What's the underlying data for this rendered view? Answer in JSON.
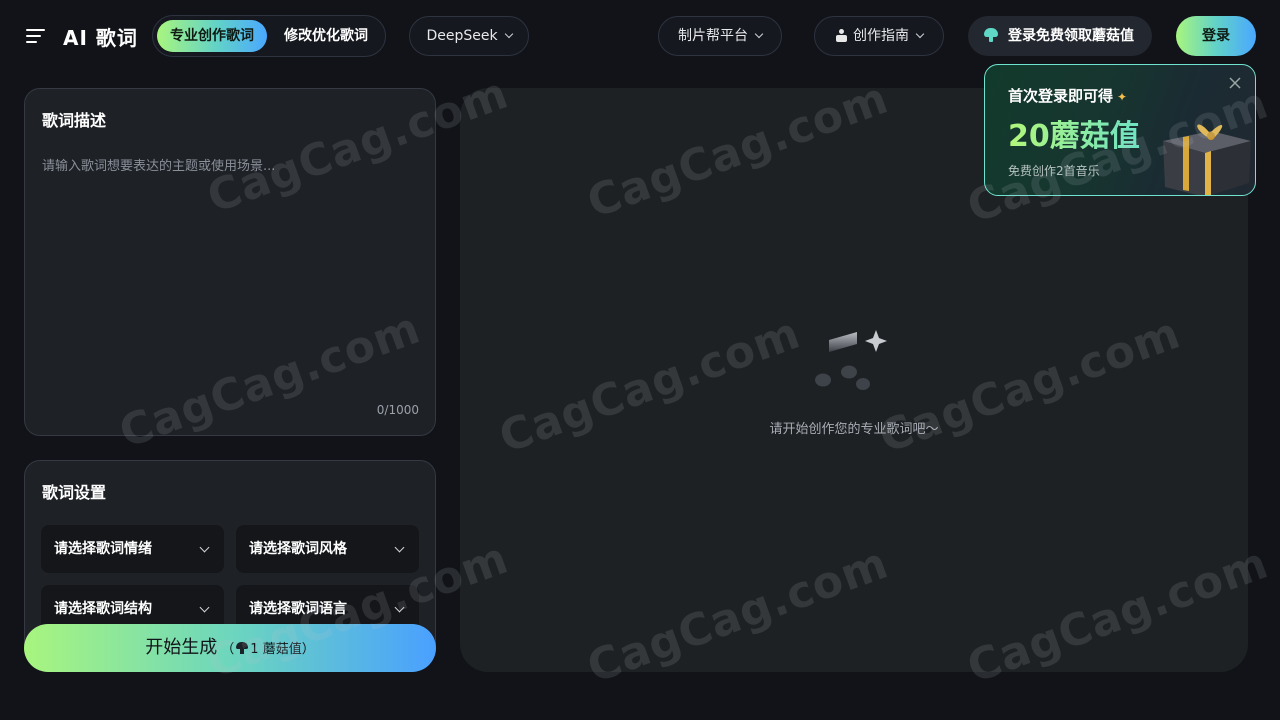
{
  "header": {
    "app_title": "AI 歌词",
    "mode_tabs": [
      {
        "label": "专业创作歌词",
        "active": true
      },
      {
        "label": "修改优化歌词",
        "active": false
      }
    ],
    "model_select": "DeepSeek",
    "platform_menu": "制片帮平台",
    "guide_menu": "创作指南",
    "promo_label": "登录免费领取蘑菇值",
    "login_label": "登录"
  },
  "lyric_card": {
    "title": "歌词描述",
    "placeholder": "请输入歌词想要表达的主题或使用场景...",
    "char_count": "0/1000"
  },
  "settings_card": {
    "title": "歌词设置",
    "selects": {
      "mood": "请选择歌词情绪",
      "style": "请选择歌词风格",
      "structure": "请选择歌词结构",
      "language": "请选择歌词语言"
    }
  },
  "generate": {
    "label": "开始生成",
    "cost_open": "（",
    "cost": "1 蘑菇值",
    "cost_close": "）"
  },
  "output": {
    "empty_text": "请开始创作您的专业歌词吧～"
  },
  "popup": {
    "title": "首次登录即可得",
    "amount": "20蘑菇值",
    "subtitle": "免费创作2首音乐"
  },
  "watermark_text": "CagCag.com",
  "colors": {
    "background": "#111318",
    "accent_start": "#a8f57e",
    "accent_end": "#4aa8ff",
    "panel": "#1e2126"
  },
  "icons": [
    "menu-icon",
    "chevron-down-icon",
    "guide-icon",
    "mushroom-icon",
    "music-note-icon",
    "sparkle-icon",
    "close-icon",
    "gift-icon"
  ]
}
